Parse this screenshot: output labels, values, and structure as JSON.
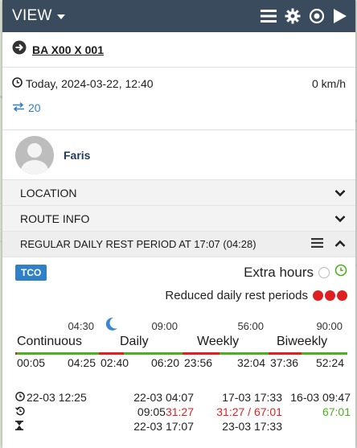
{
  "header": {
    "view_label": "VIEW"
  },
  "vehicle": {
    "plate": "BA X00 X 001"
  },
  "status": {
    "timestamp": "Today, 2024-03-22, 12:40",
    "speed": "0 km/h",
    "count": "20"
  },
  "driver": {
    "name": "Faris"
  },
  "sections": {
    "location": "LOCATION",
    "route_info": "ROUTE INFO",
    "rest_period": "REGULAR DAILY REST PERIOD AT 17:07 (04:28)"
  },
  "tco": {
    "badge": "TCO",
    "extra_hours": "Extra hours",
    "reduced_label": "Reduced daily rest periods",
    "reduced_count": 3,
    "columns": [
      {
        "limit": "04:30",
        "label": "Continuous",
        "left": "00:05",
        "right": "04:25",
        "bar_red": 0.02,
        "bar_green": 0.98
      },
      {
        "limit": "09:00",
        "label": "Daily",
        "left": "02:40",
        "right": "06:20",
        "bar_red": 0.3,
        "bar_green": 0.7
      },
      {
        "limit": "56:00",
        "label": "Weekly",
        "left": "23:56",
        "right": "32:04",
        "bar_red": 0.43,
        "bar_green": 0.57
      },
      {
        "limit": "90:00",
        "label": "Biweekly",
        "left": "37:36",
        "right": "52:24",
        "bar_red": 0.42,
        "bar_green": 0.58
      }
    ],
    "table": {
      "row1": [
        "22-03 12:25",
        "22-03 04:07",
        "17-03 17:33",
        "16-03 09:47"
      ],
      "row2": {
        "c1a": "09:05",
        "c1b": "31:27",
        "c2a": "31:27 / 67:01",
        "c3": "67:01"
      },
      "row3": [
        "",
        "22-03 17:07",
        "23-03 17:33",
        ""
      ]
    }
  },
  "colors": {
    "header_bg": "#3a4b5e",
    "accent": "#2f80c7",
    "red": "#e02020",
    "green": "#4caf1e"
  }
}
